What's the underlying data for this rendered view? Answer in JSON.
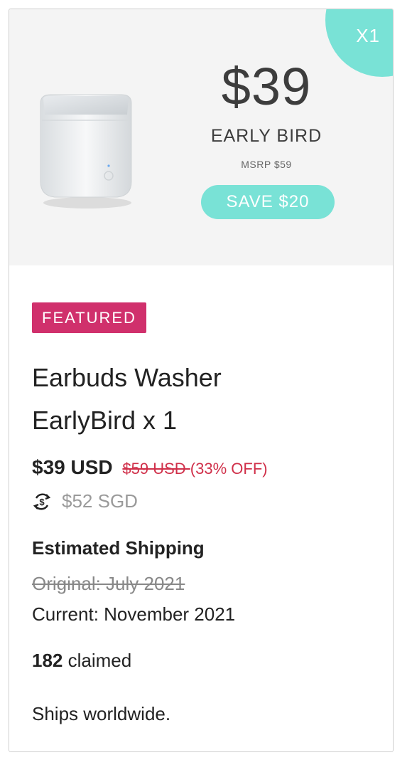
{
  "corner_label": "X1",
  "hero": {
    "price": "$39",
    "tag": "EARLY BIRD",
    "msrp": "MSRP $59",
    "save": "SAVE $20"
  },
  "badge": "FEATURED",
  "title_line1": "Earbuds Washer",
  "title_line2": "EarlyBird x 1",
  "price": {
    "current": "$39 USD",
    "original": "$59 USD ",
    "discount": "(33% OFF)"
  },
  "converted_price": "$52 SGD",
  "shipping": {
    "heading": "Estimated Shipping",
    "original": "Original: July 2021",
    "current": "Current: November 2021"
  },
  "claimed": {
    "count": "182",
    "label": " claimed"
  },
  "ships_note": "Ships worldwide.",
  "colors": {
    "accent_teal": "#79e2d6",
    "badge_pink": "#d0306c",
    "discount_red": "#d0304a"
  },
  "icons": {
    "currency": "currency-convert-icon"
  }
}
